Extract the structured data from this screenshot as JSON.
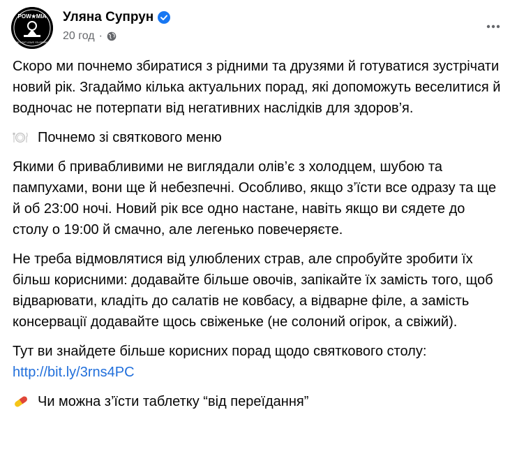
{
  "post": {
    "author": "Уляна Супрун",
    "time": "20 год",
    "meta_separator": "·",
    "avatar_text_top": "POW★MIA",
    "avatar_text_bottom": "WE DON'T LEAVE YOU BEHIND",
    "paragraphs": [
      "Скоро ми почнемо збиратися з рідними та друзями й готуватися зустрічати новий рік. Згадаймо кілька актуальних порад, які допоможуть веселитися й водночас не потерпати від негативних наслідків для здоров’я."
    ],
    "section1": {
      "icon": "plate-icon",
      "text": "Почнемо зі святкового меню"
    },
    "paragraphs2": [
      "Якими б привабливими не виглядали олів’є з холодцем, шубою та пампухами, вони ще й небезпечні. Особливо, якщо з’їсти все одразу та ще й об 23:00 ночі. Новий рік все одно настане, навіть якщо ви сядете до столу о 19:00 й смачно, але легенько повечеряєте.",
      "Не треба відмовлятися від улюблених страв, але спробуйте зробити їх більш корисними: додавайте більше овочів, запікайте їх замість того, щоб відварювати, кладіть до салатів не ковбасу, а відварне філе, а замість консервації додавайте щось свіженьке (не солоний огірок, а свіжий)."
    ],
    "tip_text": "Тут ви знайдете більше корисних порад щодо святкового столу:",
    "tip_link": "http://bit.ly/3rns4PC",
    "section2": {
      "icon": "pill-icon",
      "text": "Чи можна з’їсти таблетку “від переїдання”"
    },
    "colors": {
      "link": "#216fdb",
      "verified": "#1877f2",
      "meta": "#65676b"
    }
  }
}
